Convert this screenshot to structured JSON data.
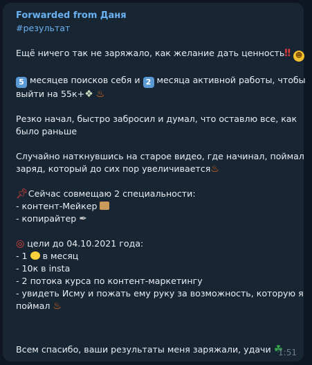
{
  "message": {
    "forwarded_from": "Forwarded from Даня",
    "hashtag": "#результат",
    "p1": "Ещё ничего так не заряжало, как желание дать ценность",
    "p2_a": "месяцев поисков себя и",
    "p2_b": "месяца активной работы, чтобы",
    "p2_c": "выйти на 55к+",
    "keycap_5": "5",
    "keycap_2": "2",
    "p3_l1": "Резко начал, быстро забросил и думал, что оставлю все, как",
    "p3_l2": "было раньше",
    "p4_l1": "Случайно наткнувшись на старое видео, где начинал, поймал",
    "p4_l2": "заряд, который до сих пор увеличивается",
    "p5_head": "Сейчас совмещаю 2 специальности:",
    "p5_i1": "- контент-Мейкер",
    "p5_i2": "- копирайтер",
    "p6_head": " цели до 04.10.2021 года:",
    "p6_i1_a": "- 1",
    "p6_i1_b": "в месяц",
    "p6_i2": "- 10к в insta",
    "p6_i3": "- 2 потока курса по контент-маркетингу",
    "p6_i4_l1": "- увидеть Исму и пожать ему руку за возможность, которую я",
    "p6_i4_l2": "поймал",
    "last": "Всем спасибо, ваши результаты меня заряжали, удачи",
    "time": "1:51"
  },
  "colors": {
    "background": "#0e1621",
    "bubble": "#182533",
    "accent": "#6ab2f2",
    "text": "#e9eef3",
    "time": "#6d7f8f"
  },
  "icons": [
    "double-exclamation-icon",
    "grinning-face-icon",
    "keycap-5-icon",
    "keycap-2-icon",
    "money-wings-icon",
    "fire-icon",
    "pushpin-icon",
    "scroll-icon",
    "pen-icon",
    "target-icon",
    "lemon-icon",
    "four-leaf-clover-icon"
  ]
}
